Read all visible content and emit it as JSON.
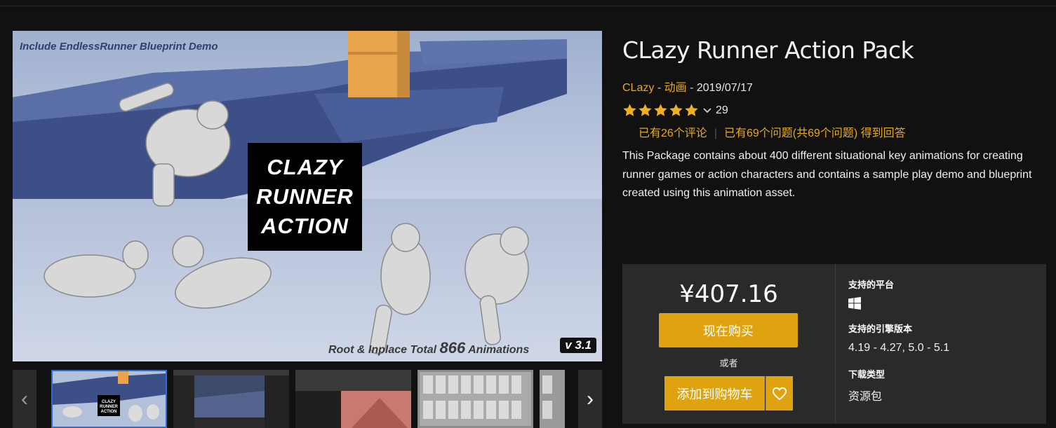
{
  "product": {
    "title": "CLazy Runner Action Pack",
    "seller": "CLazy",
    "separator": "-",
    "category": "动画",
    "date": "2019/07/17",
    "rating_stars": 5,
    "rating_count": "29",
    "reviews_link": "已有26个评论",
    "questions_link": "已有69个问题(共69个问题) 得到回答",
    "description": "This Package contains about 400 different situational key animations for creating runner games or action characters and contains a sample play demo and blueprint created using this animation asset."
  },
  "gallery": {
    "hero_caption_top": "Include EndlessRunner Blueprint Demo",
    "hero_title_lines": [
      "CLAZY",
      "RUNNER",
      "ACTION"
    ],
    "hero_caption_bottom_prefix": "Root & Inplace Total",
    "hero_caption_bottom_number": "866",
    "hero_caption_bottom_suffix": "Animations",
    "hero_version": "v 3.1",
    "prev_arrow": "‹",
    "next_arrow": "›"
  },
  "purchase": {
    "price": "¥407.16",
    "buy_now": "现在购买",
    "or": "或者",
    "add_to_cart": "添加到购物车",
    "accent_color": "#dea30e"
  },
  "specs": {
    "platforms_label": "支持的平台",
    "platform_icon": "windows-icon",
    "engine_label": "支持的引擎版本",
    "engine_value": "4.19 - 4.27, 5.0 - 5.1",
    "download_label": "下载类型",
    "download_value": "资源包"
  },
  "colors": {
    "background": "#111111",
    "link": "#e8a91b",
    "panel": "#2a2a2a"
  }
}
